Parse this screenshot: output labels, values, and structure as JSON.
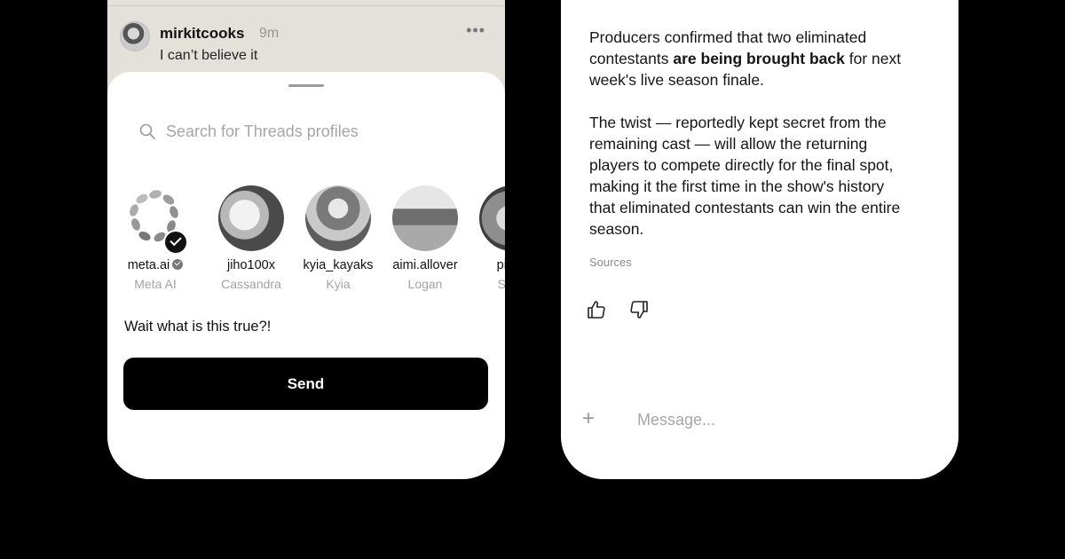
{
  "left_phone": {
    "post": {
      "username": "mirkitcooks",
      "time": "9m",
      "more": "•••",
      "text": "I can’t believe it"
    },
    "share_sheet": {
      "search": {
        "placeholder": "Search for Threads profiles",
        "icon": "search-icon"
      },
      "profiles": [
        {
          "username": "meta.ai",
          "display_name": "Meta AI",
          "verified": true
        },
        {
          "username": "jiho100x",
          "display_name": "Cassandra"
        },
        {
          "username": "kyia_kayaks",
          "display_name": "Kyia"
        },
        {
          "username": "aimi.allover",
          "display_name": "Logan"
        },
        {
          "username": "pia.in",
          "display_name": "Sooa"
        }
      ],
      "message": "Wait what is this true?!",
      "send_label": "Send"
    }
  },
  "right_phone": {
    "paragraphs": [
      {
        "before": "Producers confirmed that two eliminated contestants ",
        "bold": "are being brought back",
        "after": " for next week's live season finale."
      },
      {
        "before": "The twist — reportedly kept secret from the remaining cast — will allow the returning players to compete directly for the final spot, making it the first time in the show's history that eliminated contestants can win the entire season.",
        "bold": "",
        "after": ""
      }
    ],
    "sources_label": "Sources",
    "reactions": [
      "thumbs-up-icon",
      "thumbs-down-icon"
    ],
    "composer": {
      "plus": "+",
      "placeholder": "Message..."
    }
  }
}
